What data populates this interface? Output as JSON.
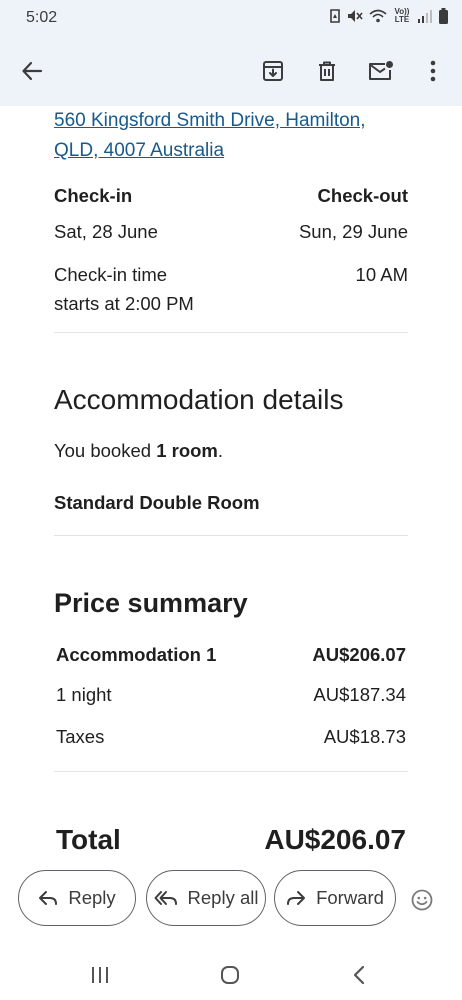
{
  "status_bar": {
    "time": "5:02",
    "network_label": "Vo)) LTE"
  },
  "toolbar": {
    "back_icon": "arrow-back-icon",
    "archive_icon": "archive-icon",
    "delete_icon": "trash-icon",
    "mark_unread_icon": "mail-unread-icon",
    "more_icon": "more-vert-icon"
  },
  "email": {
    "address_line1": "560 Kingsford Smith Drive, Hamilton,",
    "address_line2": "QLD, 4007 Australia",
    "checkin_label": "Check-in",
    "checkout_label": "Check-out",
    "checkin_date": "Sat, 28 June",
    "checkout_date": "Sun, 29 June",
    "checkin_time_line1": "Check-in time",
    "checkin_time_line2": "starts at 2:00 PM",
    "checkout_time": "10 AM",
    "accommodation_title": "Accommodation details",
    "booked_prefix": "You booked ",
    "booked_rooms": "1 room",
    "booked_suffix": ".",
    "room_type": "Standard Double Room",
    "price_title": "Price summary",
    "price_rows": [
      {
        "label": "Accommodation 1",
        "value": "AU$206.07"
      },
      {
        "label": "1 night",
        "value": "AU$187.34"
      },
      {
        "label": "Taxes",
        "value": "AU$18.73"
      }
    ],
    "total_label": "Total",
    "total_value": "AU$206.07"
  },
  "reply_bar": {
    "reply": "Reply",
    "reply_all": "Reply all",
    "forward": "Forward"
  },
  "colors": {
    "header_bg": "#eef3fa",
    "link": "#1a5a8a"
  }
}
